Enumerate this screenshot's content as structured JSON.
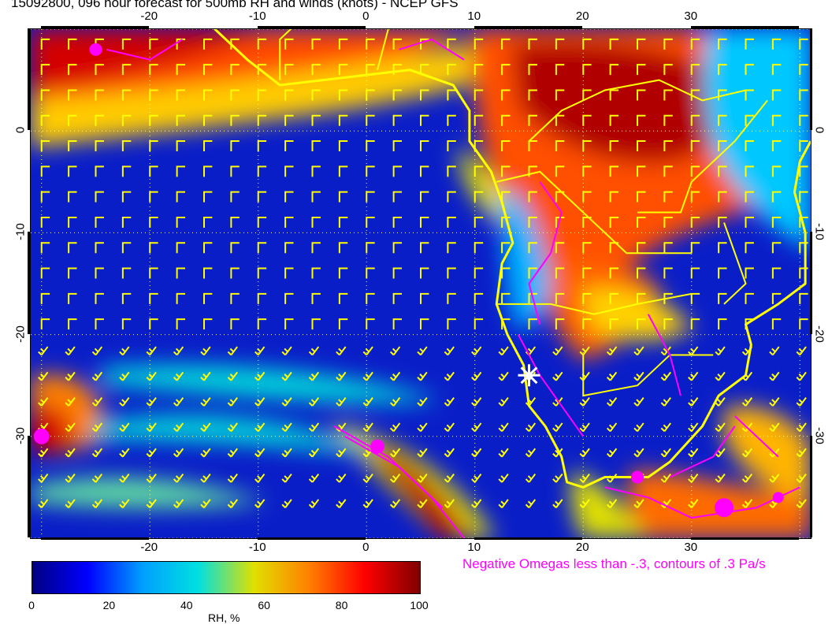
{
  "title": "15092800, 096 hour forecast for 500mb RH and winds (knots) - NCEP GFS",
  "map": {
    "lon_range": [
      -31,
      41
    ],
    "lat_range": [
      -40,
      10
    ],
    "lon_ticks": [
      "-20",
      "-10",
      "0",
      "10",
      "20",
      "30"
    ],
    "lat_ticks": [
      "0",
      "-10",
      "-20",
      "-30"
    ],
    "grid": "dotted",
    "overlay_color": "#ffff00",
    "omega_color": "#ff00ff",
    "marker": "white-star",
    "marker_position": {
      "lon": 15,
      "lat": -24
    }
  },
  "colorbar": {
    "label": "RH, %",
    "ticks": [
      "0",
      "20",
      "40",
      "60",
      "80",
      "100"
    ],
    "colors": [
      "#000080",
      "#0000ff",
      "#00a0ff",
      "#00e0e0",
      "#e0e000",
      "#ff8000",
      "#ff0000",
      "#800000"
    ]
  },
  "omega_note": "Negative Omegas less than -.3, contours of .3 Pa/s"
}
